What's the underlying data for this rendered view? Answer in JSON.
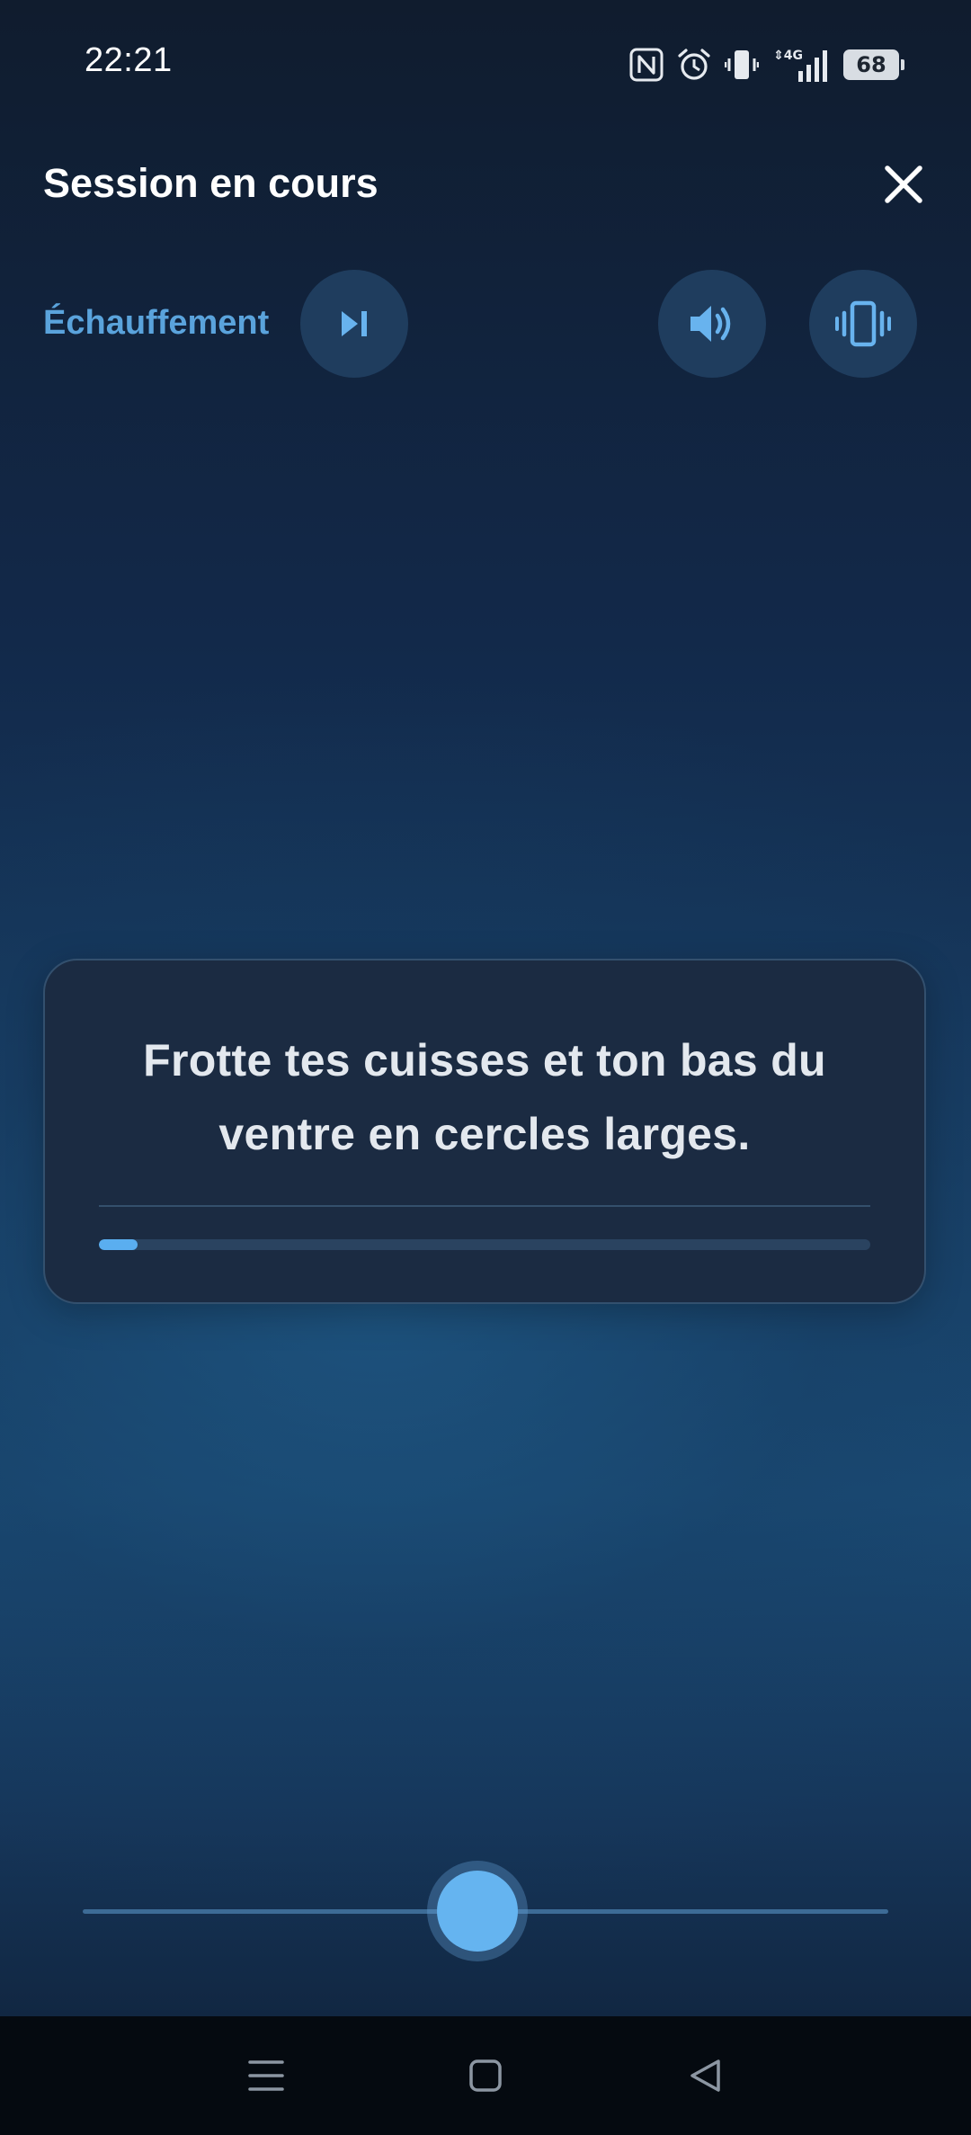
{
  "status_bar": {
    "time": "22:21",
    "network": "4G",
    "battery_level": "68",
    "icons": [
      "nfc-icon",
      "alarm-icon",
      "vibrate-mode-icon",
      "signal-icon",
      "battery-icon"
    ]
  },
  "header": {
    "title": "Session en cours",
    "close_icon": "close-icon"
  },
  "controls": {
    "phase_label": "Échauffement",
    "skip_icon": "skip-next-icon",
    "sound_icon": "volume-icon",
    "vibrate_icon": "vibration-icon"
  },
  "instruction": {
    "text": "Frotte tes cuisses et ton bas du ventre en cercles larges.",
    "progress_percent": 5
  },
  "intensity_slider": {
    "value_fraction": 0.49
  },
  "navigation": {
    "icons": [
      "menu-icon",
      "home-icon",
      "back-icon"
    ]
  },
  "colors": {
    "accent": "#5aa3dc",
    "progress": "#5aaef0",
    "button_bg": "#1f3d5e",
    "card_bg": "#1b2b42"
  }
}
